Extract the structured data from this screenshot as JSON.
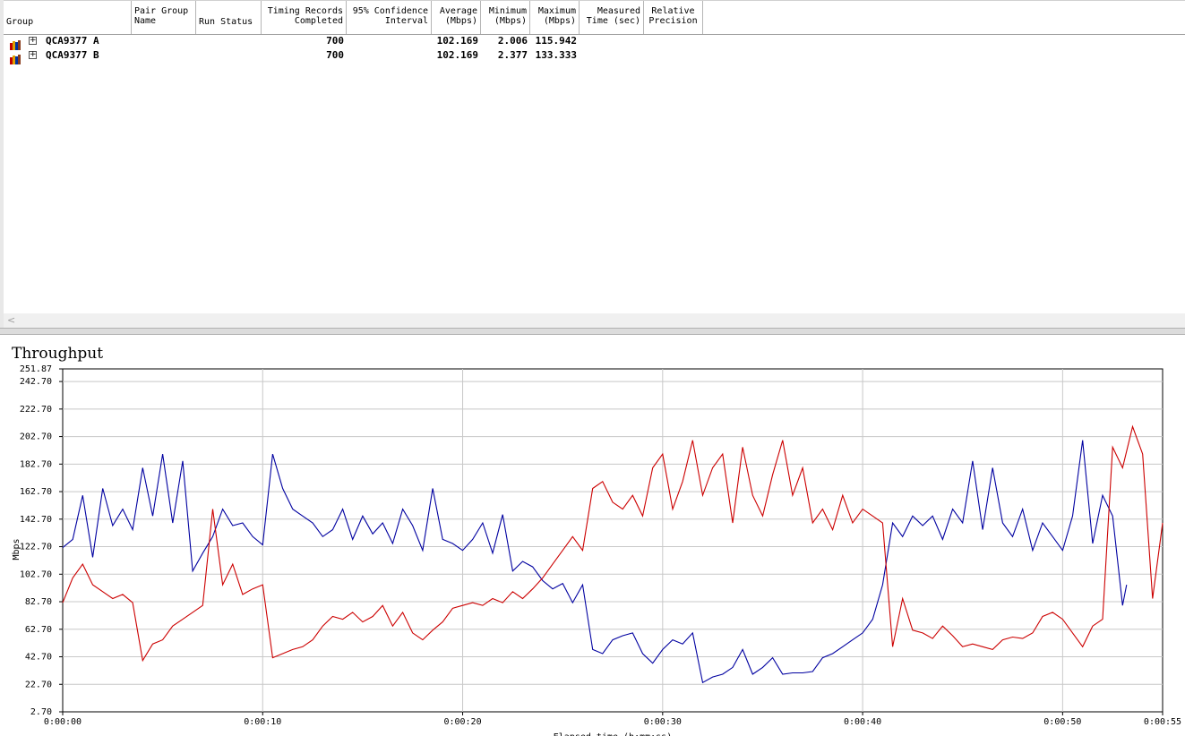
{
  "table": {
    "columns": [
      {
        "key": "group",
        "label": "Group"
      },
      {
        "key": "pair_group",
        "label": "Pair Group\nName"
      },
      {
        "key": "run_status",
        "label": "Run Status"
      },
      {
        "key": "timing",
        "label": "Timing Records\nCompleted"
      },
      {
        "key": "ci",
        "label": "95% Confidence\nInterval"
      },
      {
        "key": "avg",
        "label": "Average\n(Mbps)"
      },
      {
        "key": "min",
        "label": "Minimum\n(Mbps)"
      },
      {
        "key": "max",
        "label": "Maximum\n(Mbps)"
      },
      {
        "key": "mtime",
        "label": "Measured\nTime (sec)"
      },
      {
        "key": "rp",
        "label": "Relative\nPrecision"
      }
    ],
    "rows": [
      {
        "name": "QCA9377 A",
        "timing": "700",
        "avg": "102.169",
        "min": "2.006",
        "max": "115.942"
      },
      {
        "name": "QCA9377 B",
        "timing": "700",
        "avg": "102.169",
        "min": "2.377",
        "max": "133.333"
      }
    ],
    "scroll_left_glyph": "<"
  },
  "chart_data": {
    "type": "line",
    "title": "Throughput",
    "ylabel": "Mbps",
    "xlabel": "Elapsed time (h:mm:ss)",
    "ylim": [
      2.7,
      251.87
    ],
    "yticks": [
      "251.87",
      "242.70",
      "222.70",
      "202.70",
      "182.70",
      "162.70",
      "142.70",
      "122.70",
      "102.70",
      "82.70",
      "62.70",
      "42.70",
      "22.70",
      "2.70"
    ],
    "xlim": [
      0,
      55
    ],
    "xticks": [
      "0:00:00",
      "0:00:10",
      "0:00:20",
      "0:00:30",
      "0:00:40",
      "0:00:50",
      "0:00:55"
    ],
    "grid": true,
    "series": [
      {
        "color": "#0000a0",
        "x": [
          0,
          0.5,
          1,
          1.5,
          2,
          2.5,
          3,
          3.5,
          4,
          4.5,
          5,
          5.5,
          6,
          6.5,
          7,
          7.5,
          8,
          8.5,
          9,
          9.5,
          10,
          10.5,
          11,
          11.5,
          12,
          12.5,
          13,
          13.5,
          14,
          14.5,
          15,
          15.5,
          16,
          16.5,
          17,
          17.5,
          18,
          18.5,
          19,
          19.5,
          20,
          20.5,
          21,
          21.5,
          22,
          22.5,
          23,
          23.5,
          24,
          24.5,
          25,
          25.5,
          26,
          26.5,
          27,
          27.5,
          28,
          28.5,
          29,
          29.5,
          30,
          30.5,
          31,
          31.5,
          32,
          32.5,
          33,
          33.5,
          34,
          34.5,
          35,
          35.5,
          36,
          36.5,
          37,
          37.5,
          38,
          38.5,
          39,
          39.5,
          40,
          40.5,
          41,
          41.5,
          42,
          42.5,
          43,
          43.5,
          44,
          44.5,
          45,
          45.5,
          46,
          46.5,
          47,
          47.5,
          48,
          48.5,
          49,
          49.5,
          50,
          50.5,
          51,
          51.5,
          52,
          52.5,
          53,
          53.2
        ],
        "y": [
          122,
          128,
          160,
          115,
          165,
          138,
          150,
          135,
          180,
          145,
          190,
          140,
          185,
          105,
          118,
          130,
          150,
          138,
          140,
          130,
          124,
          190,
          165,
          150,
          145,
          140,
          130,
          135,
          150,
          128,
          145,
          132,
          140,
          125,
          150,
          138,
          120,
          165,
          128,
          125,
          120,
          128,
          140,
          118,
          146,
          105,
          112,
          108,
          98,
          92,
          96,
          82,
          95,
          48,
          45,
          55,
          58,
          60,
          45,
          38,
          48,
          55,
          52,
          60,
          24,
          28,
          30,
          35,
          48,
          30,
          35,
          42,
          30,
          31,
          31,
          32,
          42,
          45,
          50,
          55,
          60,
          70,
          95,
          140,
          130,
          145,
          138,
          145,
          128,
          150,
          140,
          185,
          135,
          180,
          140,
          130,
          150,
          120,
          140,
          130,
          120,
          145,
          200,
          125,
          160,
          145,
          80,
          95
        ]
      },
      {
        "color": "#cc0000",
        "x": [
          0,
          0.5,
          1,
          1.5,
          2,
          2.5,
          3,
          3.5,
          4,
          4.5,
          5,
          5.5,
          6,
          6.5,
          7,
          7.5,
          8,
          8.5,
          9,
          9.5,
          10,
          10.5,
          11,
          11.5,
          12,
          12.5,
          13,
          13.5,
          14,
          14.5,
          15,
          15.5,
          16,
          16.5,
          17,
          17.5,
          18,
          18.5,
          19,
          19.5,
          20,
          20.5,
          21,
          21.5,
          22,
          22.5,
          23,
          23.5,
          24,
          24.5,
          25,
          25.5,
          26,
          26.5,
          27,
          27.5,
          28,
          28.5,
          29,
          29.5,
          30,
          30.5,
          31,
          31.5,
          32,
          32.5,
          33,
          33.5,
          34,
          34.5,
          35,
          35.5,
          36,
          36.5,
          37,
          37.5,
          38,
          38.5,
          39,
          39.5,
          40,
          40.5,
          41,
          41.5,
          42,
          42.5,
          43,
          43.5,
          44,
          44.5,
          45,
          45.5,
          46,
          46.5,
          47,
          47.5,
          48,
          48.5,
          49,
          49.5,
          50,
          50.5,
          51,
          51.5,
          52,
          52.5,
          53,
          53.5,
          54,
          54.5,
          55
        ],
        "y": [
          82,
          100,
          110,
          95,
          90,
          85,
          88,
          82,
          40,
          52,
          55,
          65,
          70,
          75,
          80,
          150,
          95,
          110,
          88,
          92,
          95,
          42,
          45,
          48,
          50,
          55,
          65,
          72,
          70,
          75,
          68,
          72,
          80,
          65,
          75,
          60,
          55,
          62,
          68,
          78,
          80,
          82,
          80,
          85,
          82,
          90,
          85,
          92,
          100,
          110,
          120,
          130,
          120,
          165,
          170,
          155,
          150,
          160,
          145,
          180,
          190,
          150,
          170,
          200,
          160,
          180,
          190,
          140,
          195,
          160,
          145,
          175,
          200,
          160,
          180,
          140,
          150,
          135,
          160,
          140,
          150,
          145,
          140,
          50,
          85,
          62,
          60,
          56,
          65,
          58,
          50,
          52,
          50,
          48,
          55,
          57,
          56,
          60,
          72,
          75,
          70,
          60,
          50,
          65,
          70,
          195,
          180,
          210,
          190,
          85,
          140
        ]
      }
    ]
  }
}
